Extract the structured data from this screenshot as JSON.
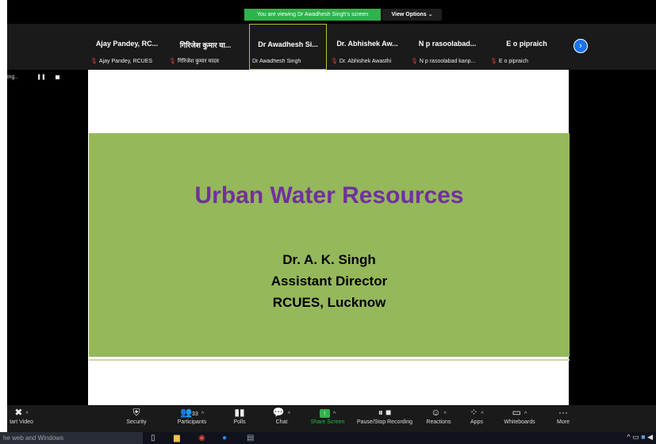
{
  "banner": {
    "text": "You are viewing Dr Awadhesh Singh's screen",
    "view_options": "View Options ⌄"
  },
  "side_status": {
    "text": "ing..",
    "pause": "❚❚"
  },
  "participants": [
    {
      "name": "Ajay Pandey, RC...",
      "sub": "Ajay Pandey, RCUES"
    },
    {
      "name": "गिरिजेश कुमार या...",
      "sub": "गिरिजेश कुमार यादव"
    },
    {
      "name": "Dr Awadhesh Si...",
      "sub": "Dr Awadhesh Singh"
    },
    {
      "name": "Dr. Abhishek Aw...",
      "sub": "Dr. Abhishek Awasthi"
    },
    {
      "name": "N p rasoolabad...",
      "sub": "N p rasoolabad kanp..."
    },
    {
      "name": "E o pipraich",
      "sub": "E o pipraich"
    }
  ],
  "slide": {
    "title": "Urban Water Resources",
    "line1": "Dr. A. K. Singh",
    "line2": "Assistant Director",
    "line3": "RCUES, Lucknow"
  },
  "toolbar": {
    "start_video": "tart Video",
    "security": "Security",
    "participants": "Participants",
    "participants_count": "33",
    "polls": "Polls",
    "chat": "Chat",
    "share_screen": "Share Screen",
    "pause_recording": "Pause/Stop Recording",
    "reactions": "Reactions",
    "apps": "Apps",
    "whiteboards": "Whiteboards",
    "more": "More"
  },
  "taskbar": {
    "search_text": "he web and Windows"
  },
  "icons": {
    "video_off": "video-off-icon",
    "security": "shield-icon",
    "participants": "people-icon",
    "polls": "bar-chart-icon",
    "chat": "chat-bubble-icon",
    "share": "share-arrow-icon",
    "record": "pause-stop-icon",
    "reactions": "emoji-icon",
    "apps": "apps-icon",
    "whiteboards": "whiteboard-icon",
    "more": "ellipsis-icon",
    "next": "chevron-right-icon"
  },
  "colors": {
    "share_green": "#2fb24c",
    "slide_green": "#95b85a",
    "title_purple": "#7030a0",
    "accent_blue": "#1a73e8"
  }
}
